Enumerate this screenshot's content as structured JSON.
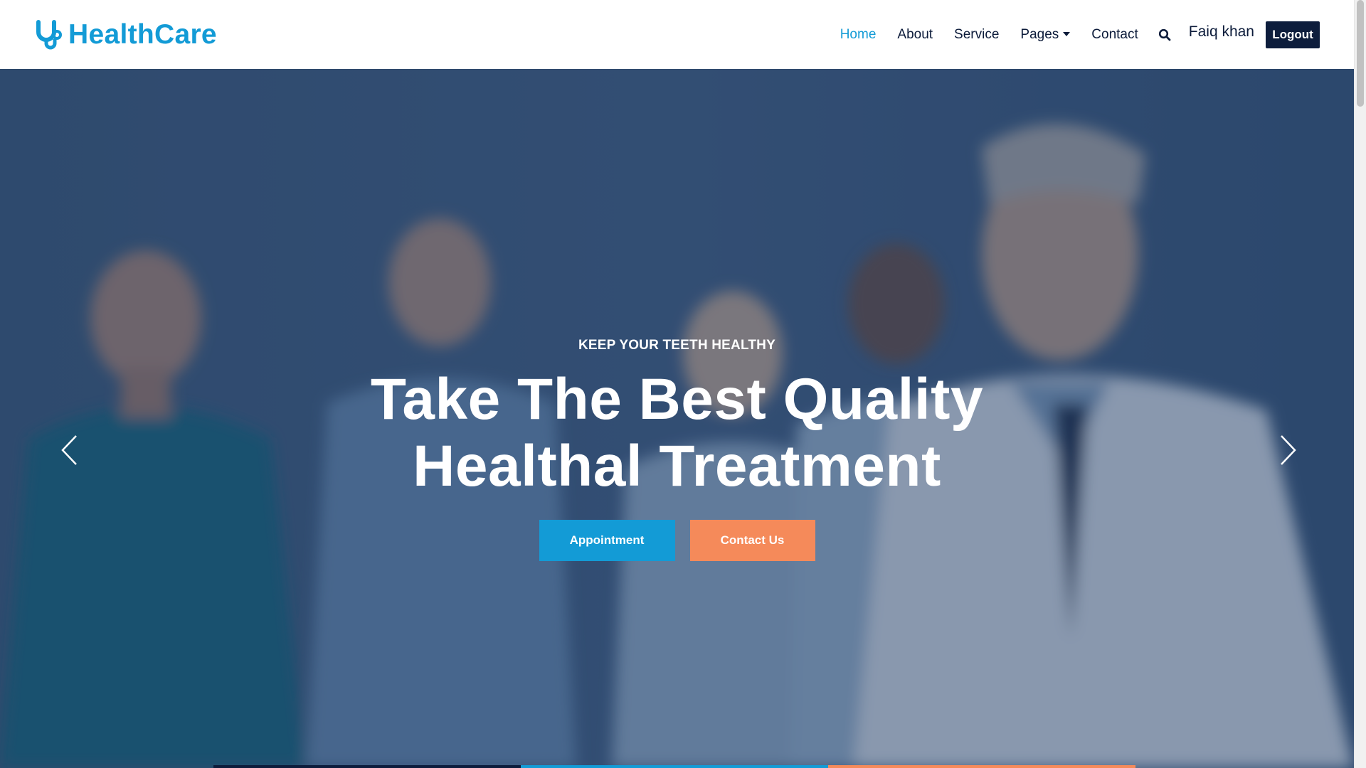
{
  "brand": {
    "name": "HealthCare",
    "icon": "stethoscope-icon",
    "color": "#139bd6"
  },
  "nav": {
    "items": [
      {
        "label": "Home",
        "active": true
      },
      {
        "label": "About",
        "active": false
      },
      {
        "label": "Service",
        "active": false
      },
      {
        "label": "Pages",
        "active": false,
        "dropdown": true
      },
      {
        "label": "Contact",
        "active": false
      }
    ],
    "search_icon": "search-icon",
    "user_name": "Faiq khan",
    "logout_label": "Logout"
  },
  "hero": {
    "eyebrow": "KEEP YOUR TEETH HEALTHY",
    "headline_line1": "Take The Best Quality",
    "headline_line2": "Healthal Treatment",
    "primary_button": "Appointment",
    "secondary_button": "Contact Us",
    "prev_icon": "chevron-left-icon",
    "next_icon": "chevron-right-icon",
    "indicator_colors": [
      "#0d1d3c",
      "#139bd6",
      "#f58a5a"
    ]
  },
  "colors": {
    "primary": "#139bd6",
    "secondary": "#f58a5a",
    "dark": "#0d1d3c"
  }
}
